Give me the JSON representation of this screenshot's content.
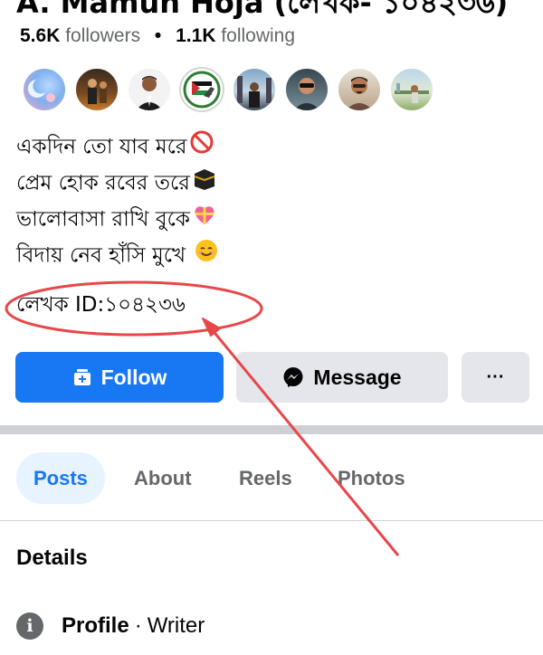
{
  "profile": {
    "name": "A. Mamun Hoja (লেখক- ১০৪২৩৬)",
    "followers_count": "5.6K",
    "followers_label": "followers",
    "dot": "•",
    "following_count": "1.1K",
    "following_label": "following"
  },
  "bio": {
    "lines": [
      "একদিন তো যাব মরে",
      "প্রেম হোক রবের তরে",
      "ভালোবাসা রাখি বুকে",
      "বিদায় নেব হাঁসি মুখে"
    ],
    "emojis": [
      "prohibited-icon",
      "kaaba-icon",
      "heart-gift-icon",
      "smile-icon"
    ],
    "writer_id": "লেখক ID:১০৪২৩৬"
  },
  "actions": {
    "follow_label": "Follow",
    "message_label": "Message",
    "more_label": "···"
  },
  "tabs": [
    {
      "label": "Posts",
      "active": true
    },
    {
      "label": "About",
      "active": false
    },
    {
      "label": "Reels",
      "active": false
    },
    {
      "label": "Photos",
      "active": false
    }
  ],
  "details": {
    "title": "Details",
    "profile_label": "Profile",
    "separator": "·",
    "profile_value": "Writer"
  },
  "colors": {
    "accent": "#1877f2",
    "annotation": "#e8474a",
    "button_gray": "#e4e6eb",
    "muted_text": "#65676b"
  }
}
